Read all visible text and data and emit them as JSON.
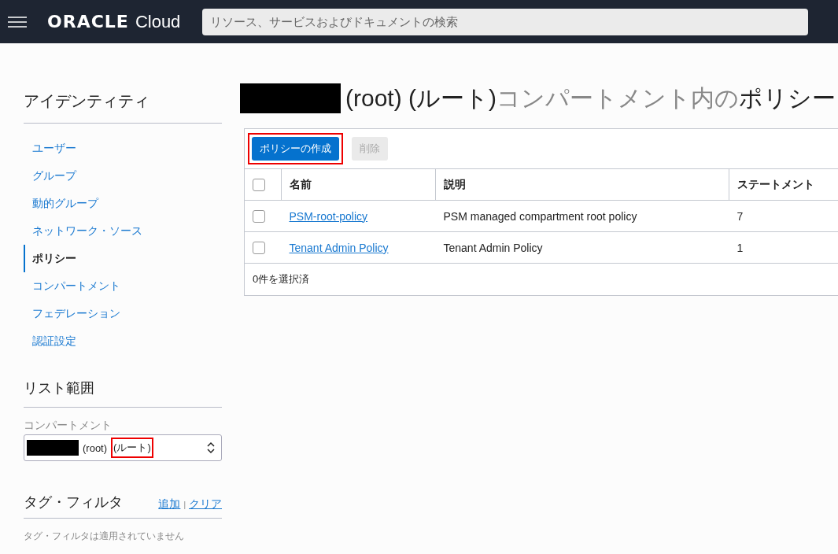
{
  "header": {
    "brand": "ORACLE",
    "product": "Cloud",
    "search": {
      "placeholder": "リソース、サービスおよびドキュメントの検索"
    }
  },
  "sidebar": {
    "title": "アイデンティティ",
    "items": [
      {
        "label": "ユーザー",
        "selected": false
      },
      {
        "label": "グループ",
        "selected": false
      },
      {
        "label": "動的グループ",
        "selected": false
      },
      {
        "label": "ネットワーク・ソース",
        "selected": false
      },
      {
        "label": "ポリシー",
        "selected": true
      },
      {
        "label": "コンパートメント",
        "selected": false
      },
      {
        "label": "フェデレーション",
        "selected": false
      },
      {
        "label": "認証設定",
        "selected": false
      }
    ],
    "scope": {
      "title": "リスト範囲",
      "field_label": "コンパートメント",
      "value_parts": [
        {
          "text": "(root)",
          "highlighted": false
        },
        {
          "text": "(ルート)",
          "highlighted": true
        }
      ]
    },
    "tag_filter": {
      "title": "タグ・フィルタ",
      "links": [
        "追加",
        "クリア"
      ],
      "separator": "|",
      "empty_text": "タグ・フィルタは適用されていません"
    }
  },
  "main": {
    "title_parts": [
      {
        "text": "(root) (ルート)",
        "muted": false
      },
      {
        "text": "コンパートメント内の",
        "muted": true
      },
      {
        "text": "ポリシー",
        "muted": false
      }
    ],
    "buttons": [
      {
        "label": "ポリシーの作成",
        "disabled": false,
        "highlighted": true
      },
      {
        "label": "削除",
        "disabled": true,
        "highlighted": false
      }
    ],
    "table": {
      "select_all_checked": false,
      "columns": [
        "名前",
        "説明",
        "ステートメント"
      ],
      "rows": [
        {
          "checked": false,
          "name": "PSM-root-policy",
          "description": "PSM managed compartment root policy",
          "statements": "7"
        },
        {
          "checked": false,
          "name": "Tenant Admin Policy",
          "description": "Tenant Admin Policy",
          "statements": "1"
        }
      ],
      "footer": "0件を選択済"
    }
  }
}
